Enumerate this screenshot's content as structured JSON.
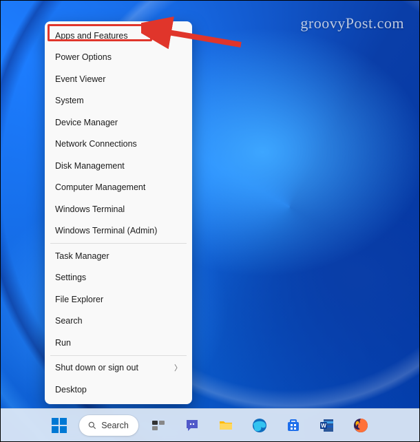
{
  "watermark": "groovyPost.com",
  "context_menu": {
    "group1": [
      {
        "id": "apps-features",
        "label": "Apps and Features"
      },
      {
        "id": "power-options",
        "label": "Power Options"
      },
      {
        "id": "event-viewer",
        "label": "Event Viewer"
      },
      {
        "id": "system",
        "label": "System"
      },
      {
        "id": "device-manager",
        "label": "Device Manager"
      },
      {
        "id": "network-connections",
        "label": "Network Connections"
      },
      {
        "id": "disk-management",
        "label": "Disk Management"
      },
      {
        "id": "computer-management",
        "label": "Computer Management"
      },
      {
        "id": "windows-terminal",
        "label": "Windows Terminal"
      },
      {
        "id": "windows-terminal-admin",
        "label": "Windows Terminal (Admin)"
      }
    ],
    "group2": [
      {
        "id": "task-manager",
        "label": "Task Manager"
      },
      {
        "id": "settings",
        "label": "Settings"
      },
      {
        "id": "file-explorer",
        "label": "File Explorer"
      },
      {
        "id": "search",
        "label": "Search"
      },
      {
        "id": "run",
        "label": "Run"
      }
    ],
    "group3": [
      {
        "id": "shutdown-signout",
        "label": "Shut down or sign out",
        "submenu": true
      },
      {
        "id": "desktop",
        "label": "Desktop"
      }
    ]
  },
  "highlight_target": "apps-features",
  "taskbar": {
    "search_label": "Search",
    "items": [
      {
        "id": "start",
        "name": "start-button"
      },
      {
        "id": "search",
        "name": "search-pill"
      },
      {
        "id": "taskview",
        "name": "task-view"
      },
      {
        "id": "chat",
        "name": "chat"
      },
      {
        "id": "explorer",
        "name": "file-explorer"
      },
      {
        "id": "edge",
        "name": "edge-browser"
      },
      {
        "id": "store",
        "name": "microsoft-store"
      },
      {
        "id": "word",
        "name": "word"
      },
      {
        "id": "firefox",
        "name": "firefox"
      }
    ]
  },
  "colors": {
    "highlight": "#e0352b",
    "accent": "#0078d4",
    "menu_bg": "#f9f9f9"
  }
}
